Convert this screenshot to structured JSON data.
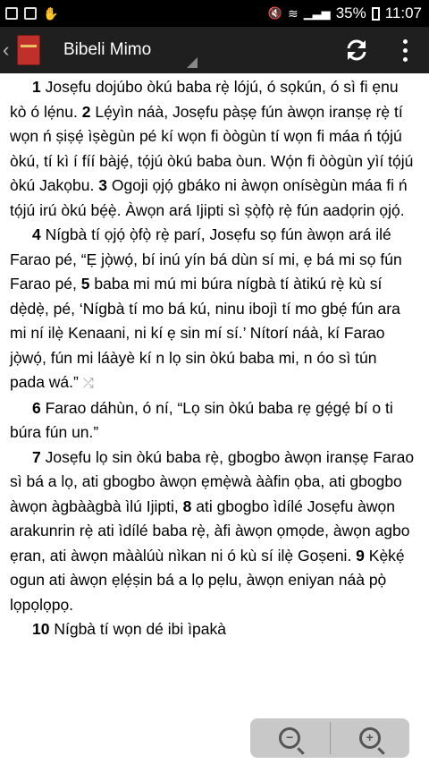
{
  "status": {
    "battery": "35%",
    "time": "11:07"
  },
  "appbar": {
    "title": "Bibeli Mimo"
  },
  "verses": [
    {
      "num": "1",
      "text": " Josẹfu dojúbo òkú baba rẹ̀ lójú, ó sọkún, ó sì fi ẹnu kò ó lẹ́nu. "
    },
    {
      "num": "2",
      "text": " Lẹ́yìn náà, Josẹfu pàṣẹ fún àwọn iranṣẹ rẹ̀ tí wọn ń ṣiṣẹ́ ìṣègùn pé kí wọn fi òògùn tí wọn fi máa ń tọ́jú òkú, tí kì í fíí bàjẹ́, tọ́jú òkú baba òun. Wọ́n fi òògùn yìí tọ́jú òkú Jakọbu. "
    },
    {
      "num": "3",
      "text": " Ogoji ọjọ́ gbáko ni àwọn onísègùn máa fi ń tọ́jú irú òkú bẹ́ẹ̀. Àwọn ará Ijipti sì ṣọ̀fọ̀ rẹ̀ fún aadọrin ọjọ́."
    },
    {
      "num": "4",
      "text": " Nígbà tí ọjọ́ ọ̀fọ̀ rẹ̀ parí, Josẹfu sọ fún àwọn ará ilé Farao pé, “Ẹ jọ̀wọ́, bí inú yín bá dùn sí mi, ẹ bá mi sọ fún Farao pé, "
    },
    {
      "num": "5",
      "text": " baba mi mú mi búra nígbà tí àtikú rẹ̀ kù sí dẹ̀dẹ̀, pé, ‘Nígbà tí mo bá kú, ninu ibojì tí mo gbẹ́ fún ara mi ní ilẹ̀ Kenaani, ni kí ẹ sin mí sí.’ Nítorí náà, kí Farao jọ̀wọ́, fún mi láàyè kí n lọ sin òkú baba mi, n óo sì tún pada wá.” "
    },
    {
      "num": "6",
      "text": " Farao dáhùn, ó ní, “Lọ sin òkú baba rẹ gẹ́gẹ́ bí o ti búra fún un.”"
    },
    {
      "num": "7",
      "text": " Josẹfu lọ sin òkú baba rẹ̀, gbogbo àwọn iranṣẹ Farao sì bá a lọ, ati gbogbo àwọn ẹmẹ̀wà ààfin ọba, ati gbogbo àwọn àgbààgbà ìlú Ijipti, "
    },
    {
      "num": "8",
      "text": " ati gbogbo ìdílé Josẹfu àwọn arakunrin rẹ̀ ati ìdílé baba rẹ̀, àfi àwọn ọmọde, àwọn agbo ẹran, ati àwọn mààlúù nìkan ni ó kù sí ilẹ̀ Goṣeni. "
    },
    {
      "num": "9",
      "text": " Kẹ̀kẹ́ ogun ati àwọn ẹlẹ́ṣin bá a lọ pẹlu, àwọn eniyan náà pọ̀ lọpọlọpọ."
    },
    {
      "num": "10",
      "text": " Nígbà tí wọn dé ibi ìpakà"
    }
  ],
  "icons": {
    "refresh": "refresh-icon",
    "menu": "overflow-menu-icon",
    "shuffle": "shuffle-icon",
    "zoom_out": "zoom-out-icon",
    "zoom_in": "zoom-in-icon"
  }
}
